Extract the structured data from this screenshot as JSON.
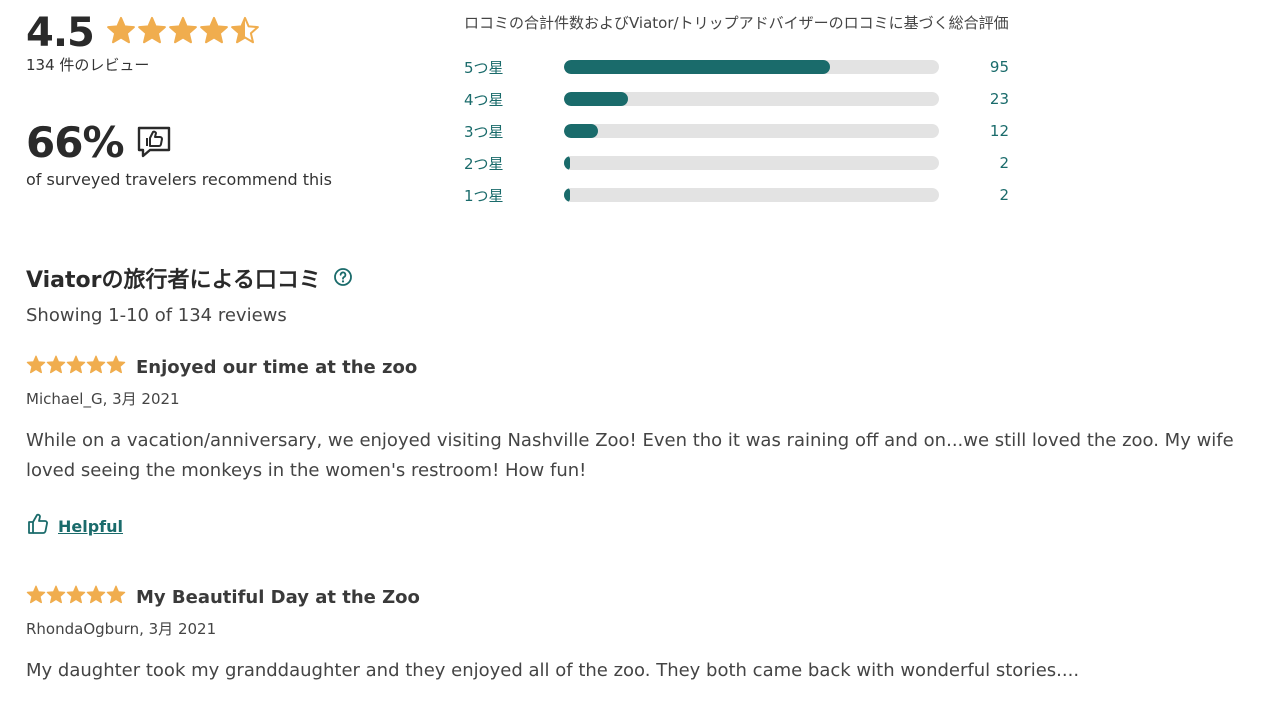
{
  "summary": {
    "rating": "4.5",
    "rating_value": 4.5,
    "review_count": "134 件のレビュー",
    "recommend_pct": "66%",
    "recommend_text": "of surveyed travelers recommend this"
  },
  "distribution": {
    "caption": "ロコミの合計件数およびViator/トリップアドバイザーのロコミに基づく総合評価",
    "rows": [
      {
        "label": "5つ星",
        "count": "95",
        "value": 95
      },
      {
        "label": "4つ星",
        "count": "23",
        "value": 23
      },
      {
        "label": "3つ星",
        "count": "12",
        "value": 12
      },
      {
        "label": "2つ星",
        "count": "2",
        "value": 2
      },
      {
        "label": "1つ星",
        "count": "2",
        "value": 2
      }
    ],
    "total": 134
  },
  "reviews_section": {
    "title": "Viatorの旅行者による口コミ",
    "showing": "Showing 1-10 of 134 reviews"
  },
  "reviews": [
    {
      "stars": 5,
      "title": "Enjoyed our time at the zoo",
      "meta": "Michael_G, 3月 2021",
      "body": "While on a vacation/anniversary, we enjoyed visiting Nashville Zoo! Even tho it was raining off and on...we still loved the zoo. My wife loved seeing the monkeys in the women's restroom! How fun!",
      "helpful_label": "Helpful"
    },
    {
      "stars": 5,
      "title": "My Beautiful Day at the Zoo",
      "meta": "RhondaOgburn, 3月 2021",
      "body": "My daughter took my granddaughter and they enjoyed all of the zoo. They both came back with wonderful stories...."
    }
  ],
  "colors": {
    "accent": "#1a6b6b",
    "star": "#f0ad4e",
    "track": "#e3e3e3"
  }
}
